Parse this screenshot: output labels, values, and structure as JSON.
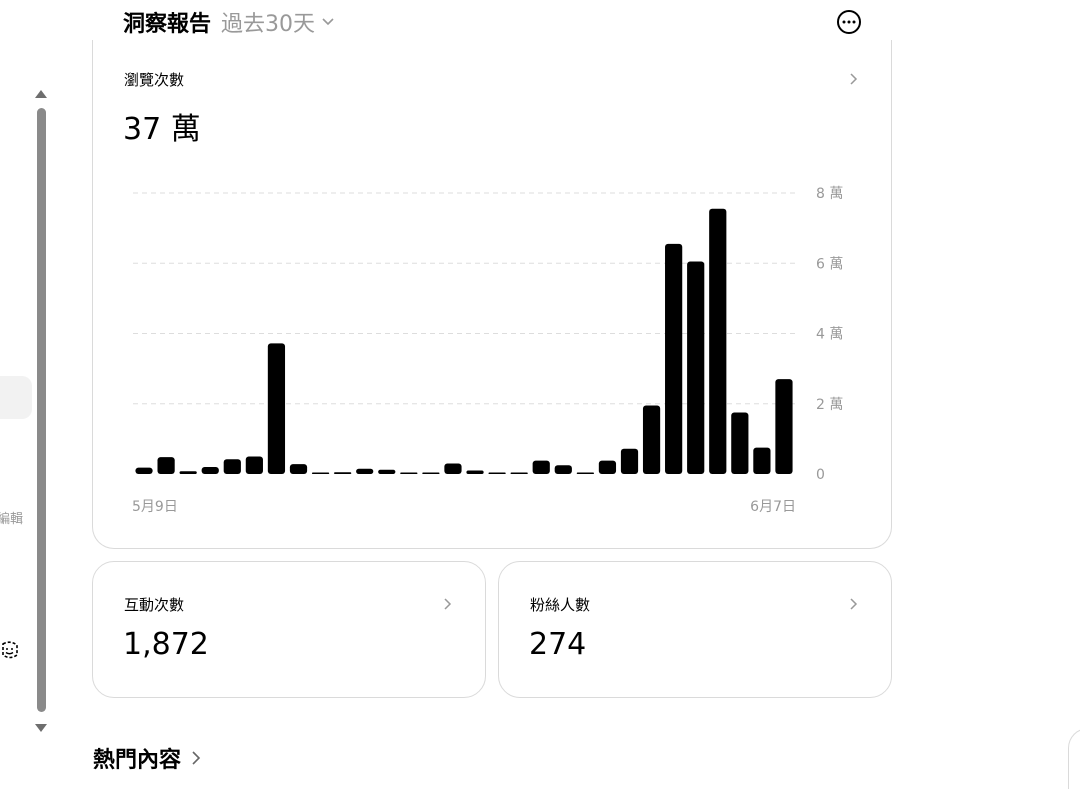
{
  "header": {
    "title": "洞察報告",
    "range_label": "過去30天"
  },
  "sidebar": {
    "partial_label": "編輯"
  },
  "views_card": {
    "label": "瀏覽次數",
    "value": "37 萬"
  },
  "chart_data": {
    "type": "bar",
    "unit": "萬",
    "ylim": [
      0,
      8
    ],
    "y_ticks": [
      0,
      2,
      4,
      6,
      8
    ],
    "y_tick_labels": [
      "0",
      "2 萬",
      "4 萬",
      "6 萬",
      "8 萬"
    ],
    "x_labels": [
      "5月9日",
      "6月7日"
    ],
    "values": [
      0.18,
      0.48,
      0.08,
      0.2,
      0.42,
      0.5,
      3.72,
      0.28,
      0.03,
      0.05,
      0.15,
      0.12,
      0.02,
      0.02,
      0.3,
      0.1,
      0.02,
      0.02,
      0.38,
      0.25,
      0.03,
      0.38,
      0.72,
      1.95,
      6.55,
      6.05,
      7.55,
      1.75,
      0.75,
      2.7
    ],
    "grid": true,
    "bar_color": "#000000",
    "grid_color": "#dddddd",
    "label_color": "#999999"
  },
  "interactions_card": {
    "label": "互動次數",
    "value": "1,872"
  },
  "followers_card": {
    "label": "粉絲人數",
    "value": "274"
  },
  "top_content": {
    "title": "熱門內容"
  },
  "icons": {
    "more": "more-horizontal-icon",
    "chevron_right": "chevron-right-icon",
    "chevron_down": "chevron-down-icon"
  }
}
